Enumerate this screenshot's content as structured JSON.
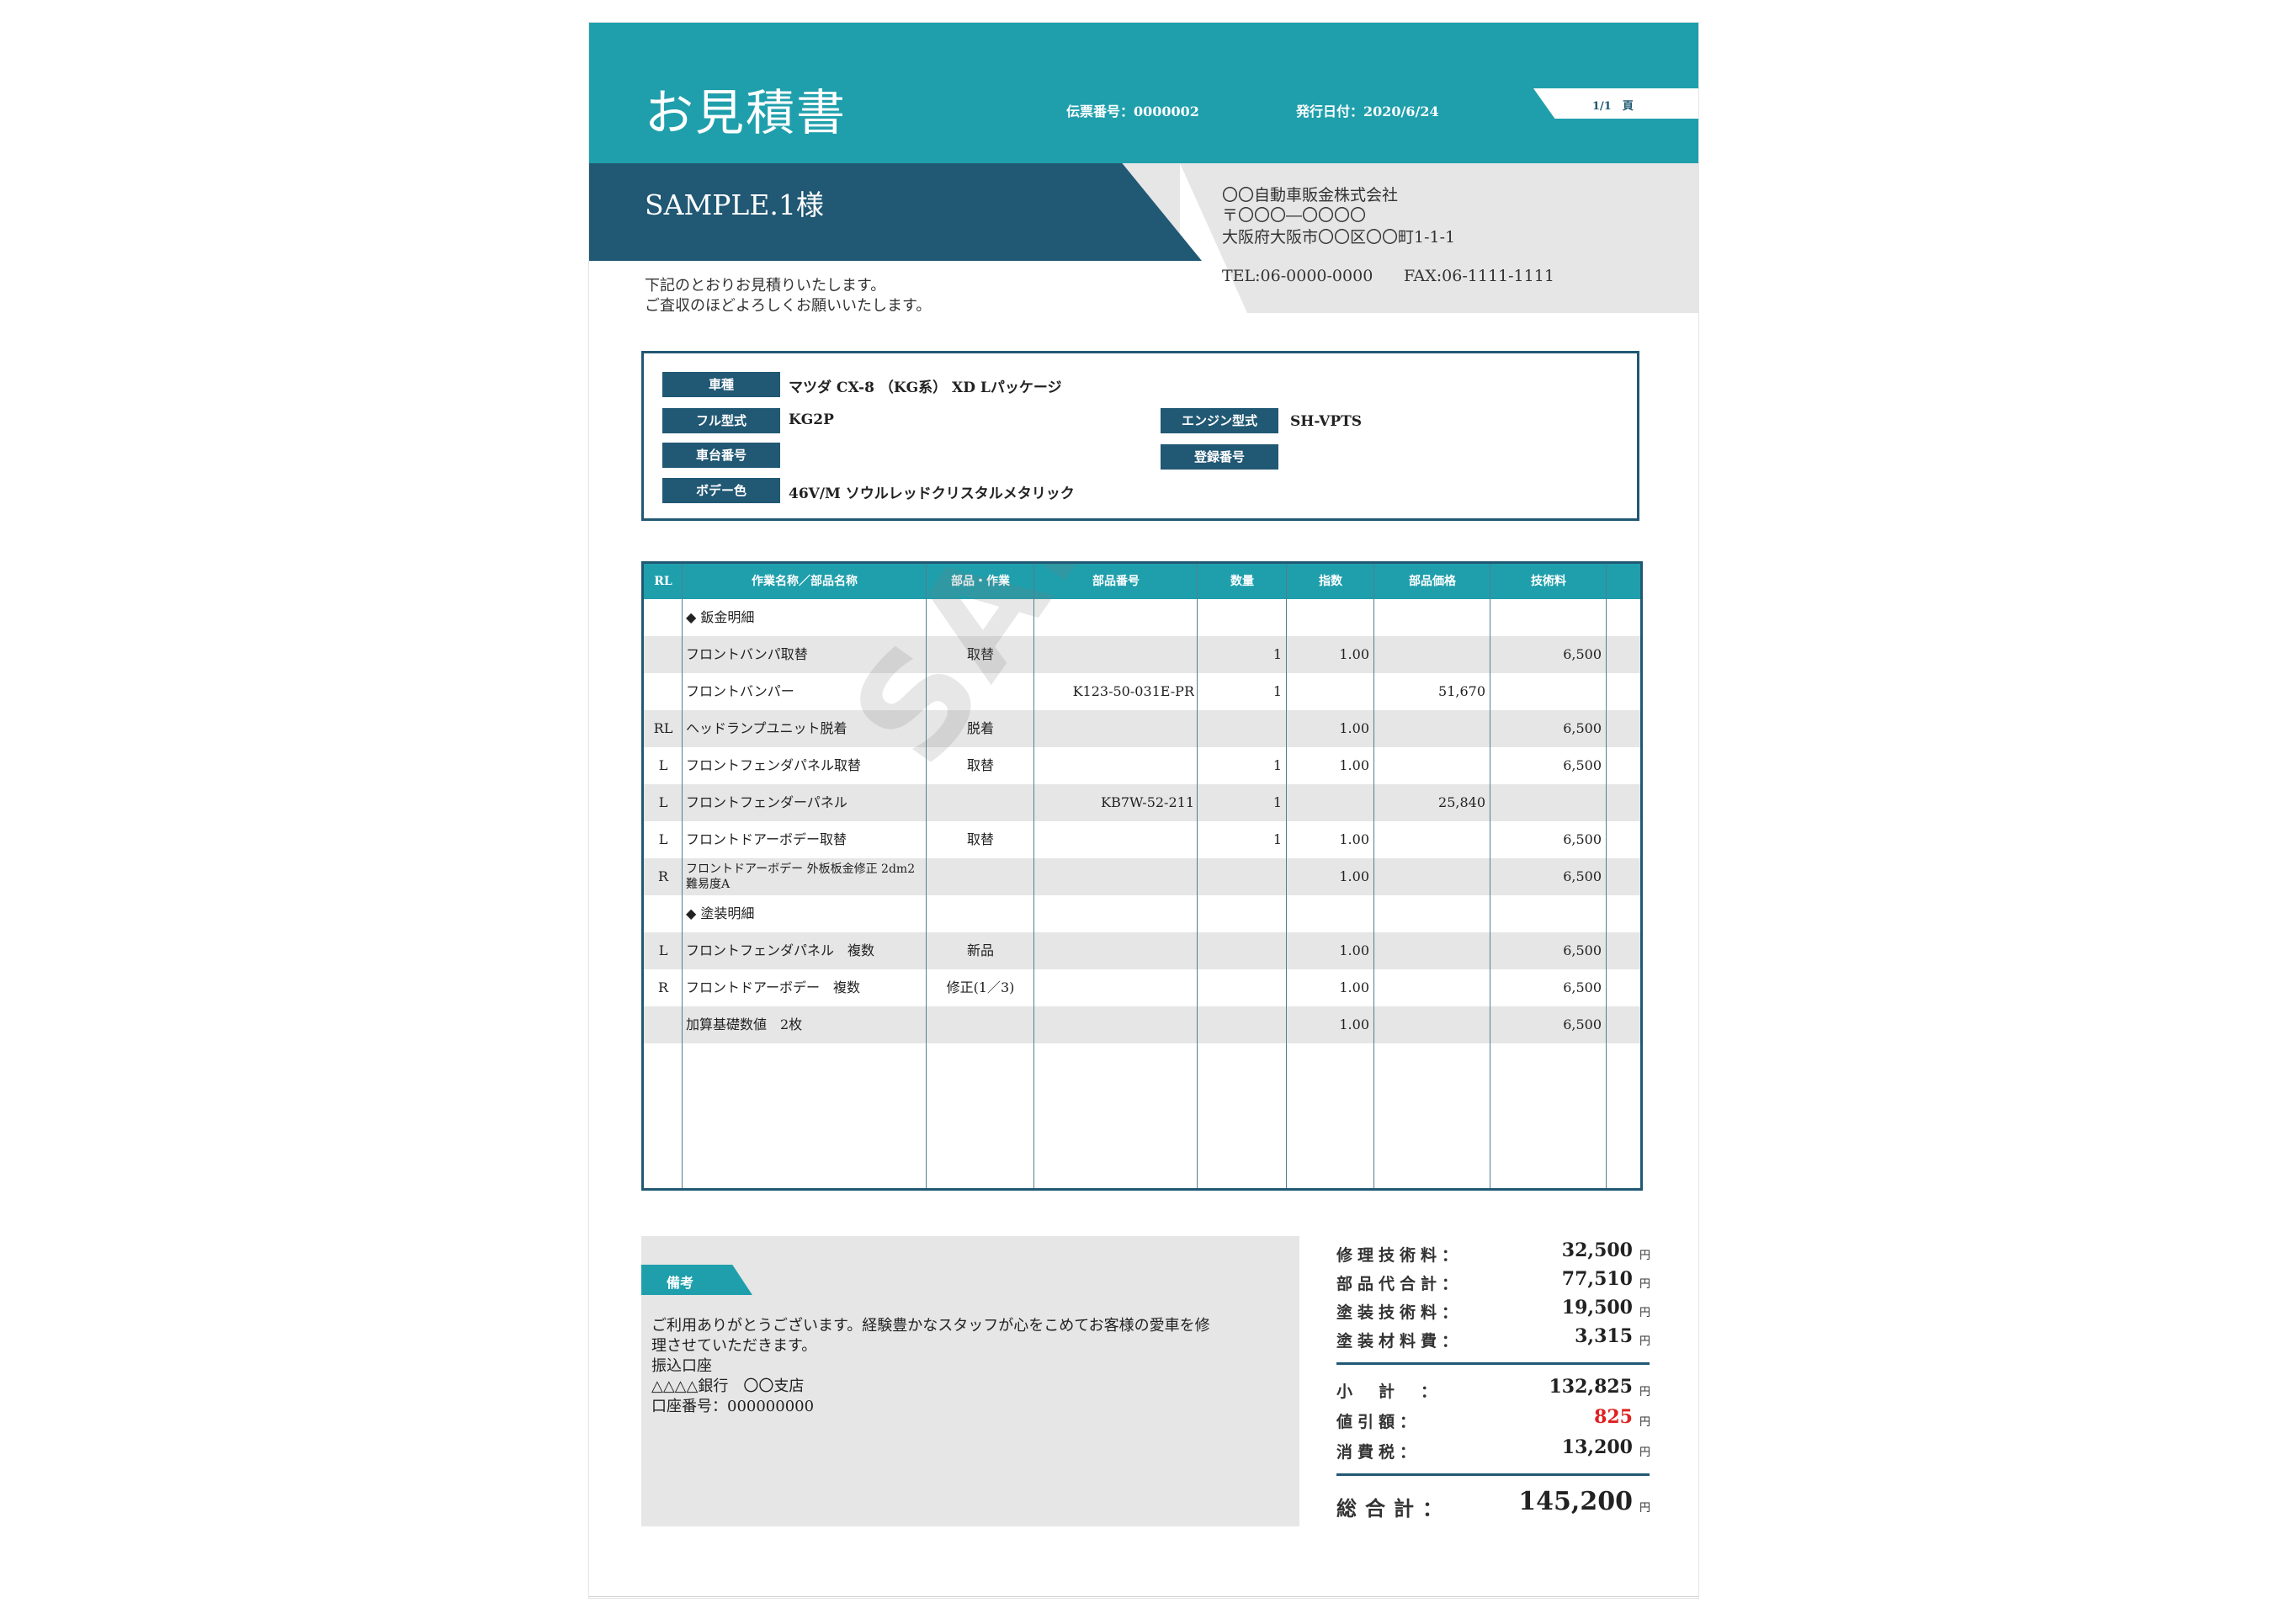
{
  "header": {
    "title": "お見積書",
    "slip_no": "伝票番号：0000002",
    "issue_date": "発行日付：2020/6/24",
    "page": "1/1　頁"
  },
  "customer": {
    "name": "SAMPLE.1様"
  },
  "company": {
    "name": "〇〇自動車販金株式会社",
    "zip": "〒〇〇〇―〇〇〇〇",
    "address": "大阪府大阪市〇〇区〇〇町1-1-1",
    "tel": "TEL:06-0000-0000",
    "fax": "FAX:06-1111-1111"
  },
  "greeting": {
    "line1": "下記のとおりお見積りいたします。",
    "line2": "ご査収のほどよろしくお願いいたします。"
  },
  "vehicle": {
    "model_label": "車種",
    "model_value": "マツダ CX-8 （KG系） XD Lパッケージ",
    "full_type_label": "フル型式",
    "full_type_value": "KG2P",
    "engine_label": "エンジン型式",
    "engine_value": "SH-VPTS",
    "chassis_label": "車台番号",
    "chassis_value": "",
    "reg_label": "登録番号",
    "reg_value": "",
    "color_label": "ボデー色",
    "color_value": "46V/M ソウルレッドクリスタルメタリック"
  },
  "table": {
    "headers": [
      "RL",
      "作業名称／部品名称",
      "部品・作業",
      "部品番号",
      "数量",
      "指数",
      "部品価格",
      "技術料"
    ],
    "rows": [
      {
        "rl": "",
        "name": "◆ 鈑金明細",
        "kind": "",
        "part_no": "",
        "qty": "",
        "index": "",
        "price": "",
        "fee": ""
      },
      {
        "rl": "",
        "name": "フロントバンパ取替",
        "kind": "取替",
        "part_no": "",
        "qty": "1",
        "index": "1.00",
        "price": "",
        "fee": "6,500"
      },
      {
        "rl": "",
        "name": "フロントバンパー",
        "kind": "",
        "part_no": "K123-50-031E-PR",
        "qty": "1",
        "index": "",
        "price": "51,670",
        "fee": ""
      },
      {
        "rl": "RL",
        "name": "ヘッドランプユニット脱着",
        "kind": "脱着",
        "part_no": "",
        "qty": "",
        "index": "1.00",
        "price": "",
        "fee": "6,500"
      },
      {
        "rl": "L",
        "name": "フロントフェンダパネル取替",
        "kind": "取替",
        "part_no": "",
        "qty": "1",
        "index": "1.00",
        "price": "",
        "fee": "6,500"
      },
      {
        "rl": "L",
        "name": "フロントフェンダーパネル",
        "kind": "",
        "part_no": "KB7W-52-211",
        "qty": "1",
        "index": "",
        "price": "25,840",
        "fee": ""
      },
      {
        "rl": "L",
        "name": "フロントドアーボデー取替",
        "kind": "取替",
        "part_no": "",
        "qty": "1",
        "index": "1.00",
        "price": "",
        "fee": "6,500"
      },
      {
        "rl": "R",
        "name": "フロントドアーボデー 外板板金修正 2dm2 難易度A",
        "kind": "",
        "part_no": "",
        "qty": "",
        "index": "1.00",
        "price": "",
        "fee": "6,500"
      },
      {
        "rl": "",
        "name": "◆ 塗装明細",
        "kind": "",
        "part_no": "",
        "qty": "",
        "index": "",
        "price": "",
        "fee": ""
      },
      {
        "rl": "L",
        "name": "フロントフェンダパネル　複数",
        "kind": "新品",
        "part_no": "",
        "qty": "",
        "index": "1.00",
        "price": "",
        "fee": "6,500"
      },
      {
        "rl": "R",
        "name": "フロントドアーボデー　複数",
        "kind": "修正(1／3)",
        "part_no": "",
        "qty": "",
        "index": "1.00",
        "price": "",
        "fee": "6,500"
      },
      {
        "rl": "",
        "name": "加算基礎数値　2枚",
        "kind": "",
        "part_no": "",
        "qty": "",
        "index": "1.00",
        "price": "",
        "fee": "6,500"
      }
    ],
    "watermark": "SAMPLE"
  },
  "remarks": {
    "label": "備考",
    "line1": "ご利用ありがとうございます。経験豊かなスタッフが心をこめてお客様の愛車を修",
    "line2": "理させていただきます。",
    "line3": "振込口座",
    "line4": "△△△△銀行　〇〇支店",
    "line5": "口座番号：000000000"
  },
  "totals": {
    "repair_fee_label": "修理技術料：",
    "repair_fee": "32,500",
    "parts_label": "部品代合計：",
    "parts": "77,510",
    "paint_fee_label": "塗装技術料：",
    "paint_fee": "19,500",
    "paint_material_label": "塗装材料費：",
    "paint_material": "3,315",
    "subtotal_label": "小　計　：",
    "subtotal": "132,825",
    "discount_label": "値引額：",
    "discount": "825",
    "tax_label": "消費税：",
    "tax": "13,200",
    "grand_label": "総合計：",
    "grand": "145,200",
    "yen": "円"
  },
  "colors": {
    "teal": "#1f9fac",
    "navy": "#215874",
    "gray": "#e6e6e6",
    "discount_red": "#e02020"
  }
}
